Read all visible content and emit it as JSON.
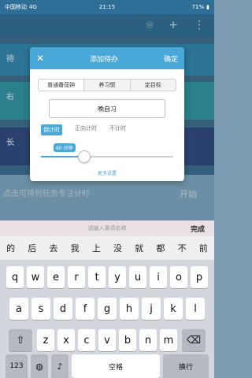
{
  "status_bar": {
    "carrier": "中国移动",
    "network": "4G",
    "time": "21:15",
    "battery": "71%"
  },
  "background": {
    "card_labels": [
      "待",
      "右",
      "长"
    ],
    "bottom_card_title": "点击可排列任务专注计时",
    "start_label": "开始"
  },
  "dialog": {
    "title": "添加待办",
    "confirm": "确定",
    "tabs": [
      "普通番茄钟",
      "养习惯",
      "定目标"
    ],
    "name_value": "晚自习",
    "modes": [
      "倒计时",
      "正向计时",
      "不计时"
    ],
    "slider": {
      "tooltip": "60 分钟",
      "fraction": 0.33
    },
    "more_settings": "更多设置"
  },
  "keyboard": {
    "input_placeholder": "请输入事项名称",
    "done": "完成",
    "candidates": [
      "的",
      "后",
      "去",
      "我",
      "上",
      "没",
      "就",
      "都",
      "不",
      "前"
    ],
    "row1": [
      "q",
      "w",
      "e",
      "r",
      "t",
      "y",
      "u",
      "i",
      "o",
      "p"
    ],
    "row2": [
      "a",
      "s",
      "d",
      "f",
      "g",
      "h",
      "j",
      "k",
      "l"
    ],
    "row3": [
      "z",
      "x",
      "c",
      "v",
      "b",
      "n",
      "m"
    ],
    "k123": "123",
    "space": "空格",
    "return": "换行"
  }
}
